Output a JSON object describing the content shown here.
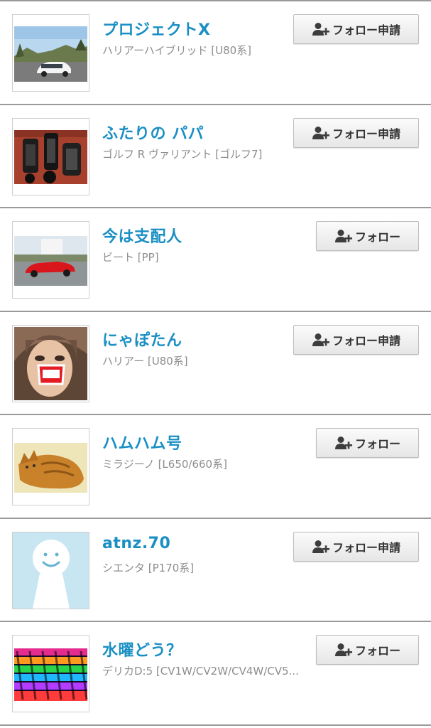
{
  "users": [
    {
      "name": "プロジェクトX",
      "car": "ハリアーハイブリッド [U80系]",
      "button_label": "フォロー申請",
      "button_type": "request",
      "avatar_icon": "car-photo-avatar"
    },
    {
      "name": "ふたりの パパ",
      "car": "ゴルフ R ヴァリアント [ゴルフ7]",
      "button_label": "フォロー申請",
      "button_type": "request",
      "avatar_icon": "camera-photo-avatar"
    },
    {
      "name": "今は支配人",
      "car": "ビート [PP]",
      "button_label": "フォロー",
      "button_type": "follow",
      "avatar_icon": "red-car-photo-avatar"
    },
    {
      "name": "にゃぽたん",
      "car": "ハリアー [U80系]",
      "button_label": "フォロー申請",
      "button_type": "request",
      "avatar_icon": "selfie-photo-avatar"
    },
    {
      "name": "ハムハム号",
      "car": "ミラジーノ [L650/660系]",
      "button_label": "フォロー",
      "button_type": "follow",
      "avatar_icon": "cat-photo-avatar"
    },
    {
      "name": "atnz.70",
      "car": "シエンタ [P170系]",
      "button_label": "フォロー申請",
      "button_type": "request",
      "avatar_icon": "default-person-avatar"
    },
    {
      "name": "水曜どう？",
      "car": "デリカD:5 [CV1W/CV2W/CV4W/CV5...",
      "button_label": "フォロー",
      "button_type": "follow",
      "avatar_icon": "colorful-pattern-avatar"
    }
  ],
  "colors": {
    "name": "#1a8fc4",
    "subtext": "#8d8d8d",
    "divider": "#9a9a9a",
    "button_text": "#333333"
  }
}
